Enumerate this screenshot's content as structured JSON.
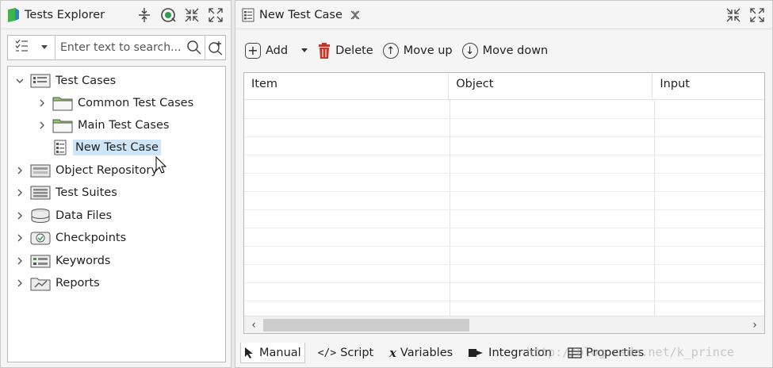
{
  "left_panel": {
    "title": "Tests Explorer",
    "search": {
      "placeholder": "Enter text to search..."
    },
    "tree": [
      {
        "label": "Test Cases",
        "expanded": true,
        "icon": "test-cases-icon",
        "depth": 0
      },
      {
        "label": "Common Test Cases",
        "expanded": false,
        "icon": "folder-icon",
        "depth": 1
      },
      {
        "label": "Main Test Cases",
        "expanded": false,
        "icon": "folder-icon",
        "depth": 1
      },
      {
        "label": "New Test Case",
        "icon": "test-case-icon",
        "depth": 1,
        "selected": true
      },
      {
        "label": "Object Repository",
        "expanded": false,
        "icon": "object-repository-icon",
        "depth": 0
      },
      {
        "label": "Test Suites",
        "expanded": false,
        "icon": "test-suites-icon",
        "depth": 0
      },
      {
        "label": "Data Files",
        "expanded": false,
        "icon": "data-files-icon",
        "depth": 0
      },
      {
        "label": "Checkpoints",
        "expanded": false,
        "icon": "checkpoints-icon",
        "depth": 0
      },
      {
        "label": "Keywords",
        "expanded": false,
        "icon": "keywords-icon",
        "depth": 0
      },
      {
        "label": "Reports",
        "expanded": false,
        "icon": "reports-icon",
        "depth": 0
      }
    ]
  },
  "editor": {
    "tab_title": "New Test Case",
    "toolbar": {
      "add": "Add",
      "delete": "Delete",
      "move_up": "Move up",
      "move_down": "Move down"
    },
    "table": {
      "columns": [
        "Item",
        "Object",
        "Input"
      ],
      "rows": []
    },
    "bottom_tabs": {
      "manual": "Manual",
      "script": "Script",
      "variables": "Variables",
      "integration": "Integration",
      "properties": "Properties"
    }
  },
  "watermark": "http://blog.csdn.net/k_prince",
  "colors": {
    "selection": "#cfe6f9",
    "folder": "#8fc86b",
    "delete_icon": "#c0392b",
    "logo_green": "#41b34a",
    "logo_blue": "#2c83c7"
  }
}
